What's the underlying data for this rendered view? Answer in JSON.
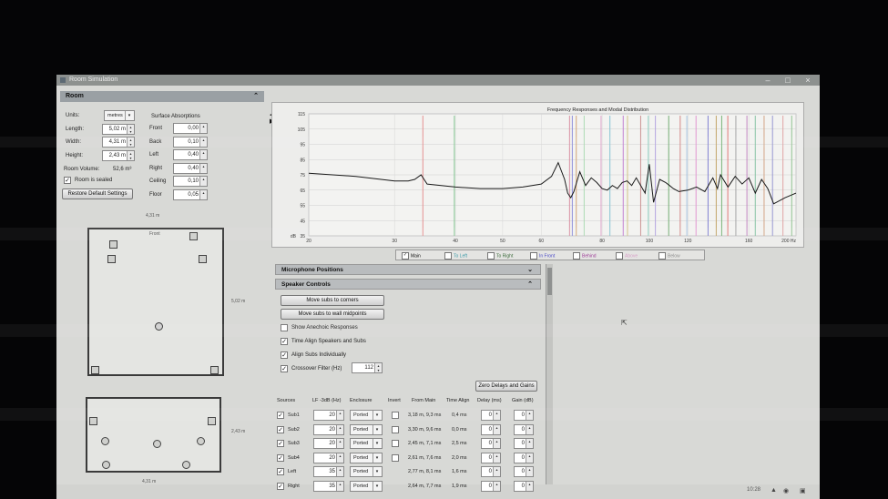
{
  "window": {
    "title": "Room Simulation"
  },
  "room": {
    "header": "Room",
    "units_label": "Units:",
    "units_value": "metres",
    "length_label": "Length:",
    "length_value": "5,02 m",
    "width_label": "Width:",
    "width_value": "4,31 m",
    "height_label": "Height:",
    "height_value": "2,43 m",
    "volume_label": "Room Volume:",
    "volume_value": "52,6 m³",
    "sealed_label": "Room is sealed",
    "restore_label": "Restore Default Settings",
    "absorption_title": "Surface Absorptions",
    "absorptions": [
      {
        "label": "Front",
        "value": "0,00"
      },
      {
        "label": "Back",
        "value": "0,10"
      },
      {
        "label": "Left",
        "value": "0,40"
      },
      {
        "label": "Right",
        "value": "0,40"
      },
      {
        "label": "Ceiling",
        "value": "0,10"
      },
      {
        "label": "Floor",
        "value": "0,05"
      }
    ]
  },
  "plan": {
    "top_width": "4,31 m",
    "front_label": "Front",
    "side_length": "5,02 m",
    "height_dim": "2,43 m",
    "bottom_width": "4,31 m"
  },
  "chart_data": {
    "type": "line",
    "title": "Frequency Responses and Modal Distribution",
    "ylabel": "dB",
    "xscale": "log",
    "xlim": [
      20,
      200
    ],
    "ylim": [
      35,
      115
    ],
    "x_ticks": [
      20,
      30,
      40,
      50,
      60,
      80,
      100,
      120,
      160,
      200
    ],
    "x_tick_labels": [
      "20",
      "30",
      "40",
      "50",
      "60",
      "80",
      "100",
      "120",
      "160",
      "200 Hz"
    ],
    "y_ticks": [
      35,
      45,
      55,
      65,
      75,
      85,
      95,
      105,
      115
    ],
    "y_tick_labels": [
      "35",
      "45",
      "55",
      "65",
      "75",
      "85",
      "95",
      "105",
      "115"
    ],
    "series": [
      {
        "name": "Main",
        "x": [
          20,
          25,
          30,
          32,
          33,
          34,
          35,
          40,
          45,
          50,
          55,
          60,
          63,
          65,
          67,
          68,
          69,
          70,
          72,
          74,
          76,
          78,
          80,
          82,
          84,
          86,
          88,
          90,
          92,
          94,
          96,
          98,
          100,
          102,
          105,
          108,
          110,
          112,
          115,
          120,
          125,
          130,
          135,
          138,
          140,
          145,
          150,
          155,
          160,
          165,
          170,
          175,
          180,
          190,
          200
        ],
        "values": [
          76,
          74,
          71,
          71,
          72,
          75,
          69,
          67,
          66,
          66,
          67,
          69,
          74,
          83,
          72,
          63,
          60,
          64,
          77,
          68,
          73,
          70,
          66,
          65,
          68,
          66,
          70,
          71,
          68,
          73,
          68,
          63,
          82,
          57,
          72,
          70,
          68,
          66,
          64,
          65,
          67,
          64,
          73,
          66,
          75,
          67,
          74,
          69,
          73,
          63,
          72,
          66,
          56,
          60,
          63
        ]
      }
    ],
    "modes": [
      {
        "freq": 34.3,
        "color": "#e58a8a"
      },
      {
        "freq": 39.8,
        "color": "#7ac48a"
      },
      {
        "freq": 68.6,
        "color": "#d98a9e"
      },
      {
        "freq": 69.5,
        "color": "#8a8ad9"
      },
      {
        "freq": 70.8,
        "color": "#d1a070"
      },
      {
        "freq": 73.5,
        "color": "#a9d9b0"
      },
      {
        "freq": 79.6,
        "color": "#e0a0c8"
      },
      {
        "freq": 83.0,
        "color": "#7fc0d0"
      },
      {
        "freq": 88.4,
        "color": "#c07ad0"
      },
      {
        "freq": 90.2,
        "color": "#d0c080"
      },
      {
        "freq": 96.0,
        "color": "#c78a8a"
      },
      {
        "freq": 99.5,
        "color": "#8ad0c0"
      },
      {
        "freq": 102.9,
        "color": "#b0a0e0"
      },
      {
        "freq": 109.6,
        "color": "#6aa86a"
      },
      {
        "freq": 115.7,
        "color": "#d08080"
      },
      {
        "freq": 119.4,
        "color": "#a0c0e0"
      },
      {
        "freq": 124.7,
        "color": "#e090d0"
      },
      {
        "freq": 132.0,
        "color": "#7a7ad0"
      },
      {
        "freq": 137.2,
        "color": "#c0a060"
      },
      {
        "freq": 140.8,
        "color": "#70b070"
      },
      {
        "freq": 144.9,
        "color": "#e07070"
      },
      {
        "freq": 150.5,
        "color": "#a0a0a0"
      },
      {
        "freq": 158.6,
        "color": "#c080c0"
      },
      {
        "freq": 165.0,
        "color": "#80c0a0"
      },
      {
        "freq": 172.0,
        "color": "#d0a080"
      },
      {
        "freq": 179.0,
        "color": "#9090d0"
      },
      {
        "freq": 188.0,
        "color": "#e0a0a0"
      },
      {
        "freq": 196.0,
        "color": "#8ac08a"
      }
    ]
  },
  "legend": [
    {
      "label": "Main",
      "checked": true,
      "color": "#111111"
    },
    {
      "label": "To Left",
      "checked": false,
      "color": "#3a9aa8"
    },
    {
      "label": "To Right",
      "checked": false,
      "color": "#3a6a3a"
    },
    {
      "label": "In Front",
      "checked": false,
      "color": "#4a4ac8"
    },
    {
      "label": "Behind",
      "checked": false,
      "color": "#a0409a"
    },
    {
      "label": "Above",
      "checked": false,
      "color": "#d8a0c8"
    },
    {
      "label": "Below",
      "checked": false,
      "color": "#909090"
    }
  ],
  "panels": {
    "mic_positions": "Microphone Positions",
    "speaker_controls": "Speaker Controls"
  },
  "speaker": {
    "move_corners": "Move subs to corners",
    "move_midpoints": "Move subs to wall midpoints",
    "show_anechoic": "Show Anechoic Responses",
    "time_align": "Time Align Speakers and Subs",
    "align_subs": "Align Subs Individually",
    "crossover_label": "Crossover Filter (Hz)",
    "crossover_value": "112",
    "zero_delays": "Zero Delays and Gains",
    "headers": {
      "sources": "Sources",
      "lf3db": "LF -3dB (Hz)",
      "enclosure": "Enclosure",
      "invert": "Invert",
      "from_main": "From Main",
      "time_align": "Time Align",
      "delay": "Delay (ms)",
      "gain": "Gain (dB)"
    },
    "rows": [
      {
        "name": "Sub1",
        "lf": "20",
        "enclosure": "Ported",
        "from_main": "3,18 m, 9,3 ms",
        "time_align": "0,4 ms",
        "delay": "0",
        "gain": "0"
      },
      {
        "name": "Sub2",
        "lf": "20",
        "enclosure": "Ported",
        "from_main": "3,30 m, 9,6 ms",
        "time_align": "0,0 ms",
        "delay": "0",
        "gain": "0"
      },
      {
        "name": "Sub3",
        "lf": "20",
        "enclosure": "Ported",
        "from_main": "2,45 m, 7,1 ms",
        "time_align": "2,5 ms",
        "delay": "0",
        "gain": "0"
      },
      {
        "name": "Sub4",
        "lf": "20",
        "enclosure": "Ported",
        "from_main": "2,61 m, 7,6 ms",
        "time_align": "2,0 ms",
        "delay": "0",
        "gain": "0"
      },
      {
        "name": "Left",
        "lf": "35",
        "enclosure": "Ported",
        "from_main": "2,77 m, 8,1 ms",
        "time_align": "1,6 ms",
        "delay": "0",
        "gain": "0"
      },
      {
        "name": "Right",
        "lf": "35",
        "enclosure": "Ported",
        "from_main": "2,64 m, 7,7 ms",
        "time_align": "1,9 ms",
        "delay": "0",
        "gain": "0"
      }
    ]
  },
  "taskbar": {
    "time": "10:28"
  }
}
